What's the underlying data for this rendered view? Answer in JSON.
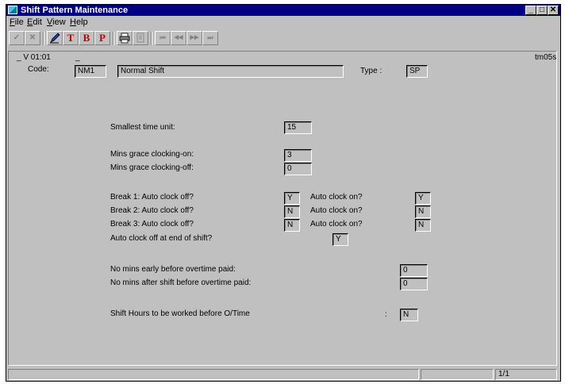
{
  "window": {
    "title": "Shift Pattern Maintenance"
  },
  "menu": [
    {
      "label": "File",
      "key": "F",
      "rest": "ile"
    },
    {
      "label": "Edit",
      "key": "E",
      "rest": "dit"
    },
    {
      "label": "View",
      "key": "V",
      "rest": "iew"
    },
    {
      "label": "Help",
      "key": "H",
      "rest": "elp"
    }
  ],
  "toolbar": {
    "ok": "✓",
    "cancel": "✕",
    "t": "T",
    "b": "B",
    "p": "P",
    "first": "⏮",
    "prev": "◀◀",
    "next": "▶▶",
    "last": "⏭"
  },
  "form": {
    "version": "_ V 01:01",
    "dash": "_",
    "screen_id": "tm05s",
    "code_label": "Code:",
    "code_value": "NM1",
    "description": "Normal Shift",
    "type_label": "Type :",
    "type_value": "SP",
    "smallest_label": "Smallest time unit:",
    "smallest_value": "15",
    "grace_on_label": "Mins grace clocking-on:",
    "grace_on_value": "3",
    "grace_off_label": "Mins grace clocking-off:",
    "grace_off_value": "0",
    "break1_label": "Break 1: Auto clock off?",
    "break1_off": "Y",
    "break1_on_label": "Auto clock on?",
    "break1_on": "Y",
    "break2_label": "Break 2: Auto clock off?",
    "break2_off": "N",
    "break2_on_label": "Auto clock on?",
    "break2_on": "N",
    "break3_label": "Break 3: Auto clock off?",
    "break3_off": "N",
    "break3_on_label": "Auto clock on?",
    "break3_on": "N",
    "end_shift_label": "Auto clock off at end of shift?",
    "end_shift_value": "Y",
    "early_label": "No mins early before overtime paid:",
    "early_value": "0",
    "after_label": "No mins after shift before overtime paid:",
    "after_value": "0",
    "hours_label": "Shift Hours to be worked before O/Time",
    "hours_colon": ":",
    "hours_value": "N"
  },
  "status": {
    "page": "1/1"
  }
}
